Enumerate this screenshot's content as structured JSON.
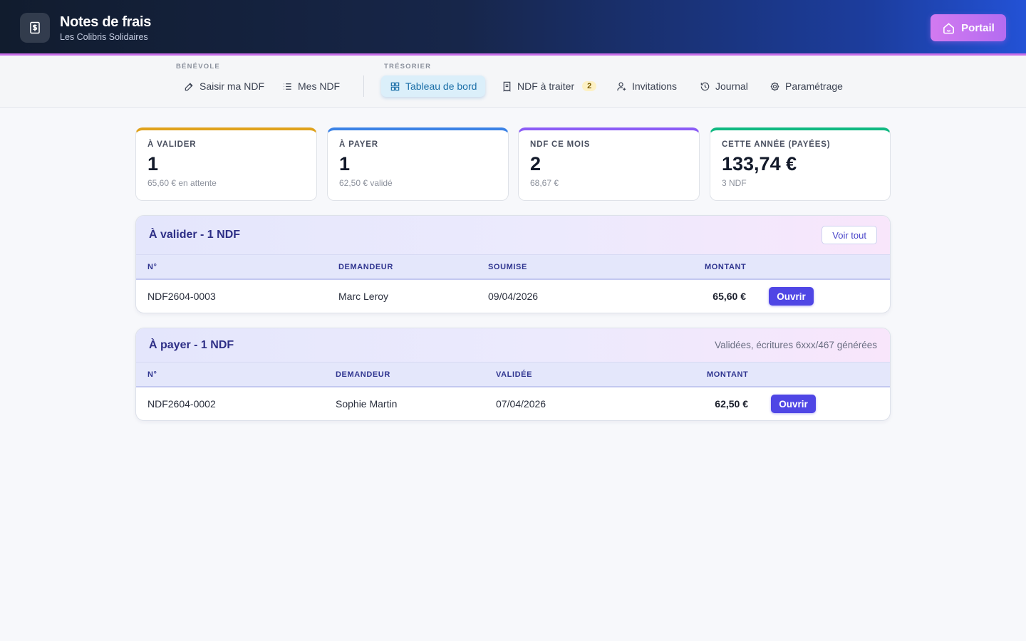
{
  "header": {
    "title": "Notes de frais",
    "subtitle": "Les Colibris Solidaires",
    "portal_label": "Portail"
  },
  "nav": {
    "benevole_label": "BÉNÉVOLE",
    "tresorier_label": "TRÉSORIER",
    "items": [
      {
        "label": "Saisir ma NDF",
        "icon": "edit-icon"
      },
      {
        "label": "Mes NDF",
        "icon": "list-icon"
      },
      {
        "label": "Tableau de bord",
        "icon": "dashboard-icon",
        "active": true
      },
      {
        "label": "NDF à traiter",
        "icon": "receipt-icon",
        "badge": "2"
      },
      {
        "label": "Invitations",
        "icon": "user-plus-icon"
      },
      {
        "label": "Journal",
        "icon": "history-icon"
      },
      {
        "label": "Paramétrage",
        "icon": "gear-icon"
      }
    ]
  },
  "stats": [
    {
      "label": "À VALIDER",
      "value": "1",
      "sub": "65,60 € en attente",
      "color": "#e0a21c"
    },
    {
      "label": "À PAYER",
      "value": "1",
      "sub": "62,50 € validé",
      "color": "#3b82e6"
    },
    {
      "label": "NDF CE MOIS",
      "value": "2",
      "sub": "68,67 €",
      "color": "#8b5cf6"
    },
    {
      "label": "CETTE ANNÉE (PAYÉES)",
      "value": "133,74 €",
      "sub": "3 NDF",
      "color": "#10b981"
    }
  ],
  "to_validate": {
    "title": "À valider - 1 NDF",
    "action": "Voir tout",
    "columns": [
      "N°",
      "DEMANDEUR",
      "SOUMISE",
      "MONTANT"
    ],
    "rows": [
      {
        "num": "NDF2604-0003",
        "requester": "Marc Leroy",
        "date": "09/04/2026",
        "amount": "65,60 €",
        "action": "Ouvrir"
      }
    ]
  },
  "to_pay": {
    "title": "À payer - 1 NDF",
    "note": "Validées, écritures 6xxx/467 générées",
    "columns": [
      "N°",
      "DEMANDEUR",
      "VALIDÉE",
      "MONTANT"
    ],
    "rows": [
      {
        "num": "NDF2604-0002",
        "requester": "Sophie Martin",
        "date": "07/04/2026",
        "amount": "62,50 €",
        "action": "Ouvrir"
      }
    ]
  }
}
